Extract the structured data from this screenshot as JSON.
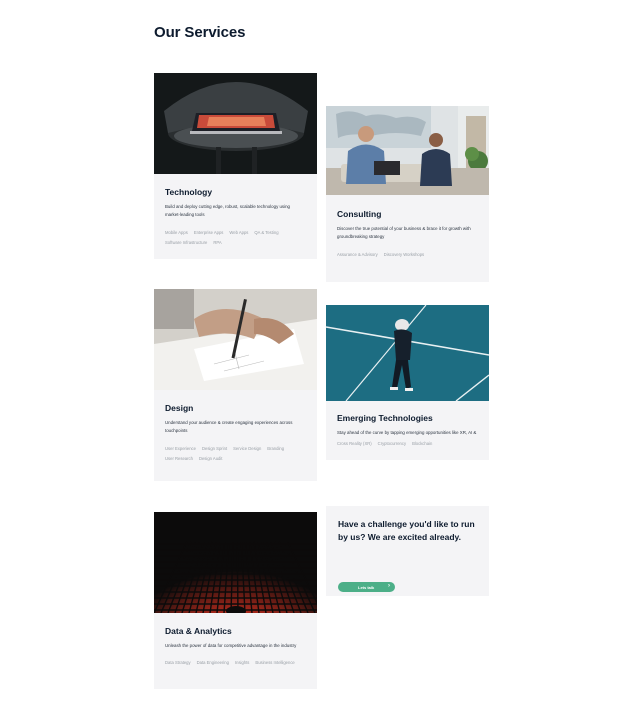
{
  "page": {
    "title": "Our Services"
  },
  "cards": {
    "technology": {
      "title": "Technology",
      "description": "Build and deploy cutting edge, robust, scalable technology using market-leading tools",
      "tags": [
        "Mobile Apps",
        "Enterprise Apps",
        "Web Apps",
        "QA & Testing",
        "Software Infrastructure",
        "RPA"
      ]
    },
    "consulting": {
      "title": "Consulting",
      "description": "Discover the true potential of your business & brace it for growth with groundbreaking strategy",
      "tags": [
        "Assurance & Advisory",
        "Discovery Workshops"
      ]
    },
    "design": {
      "title": "Design",
      "description": "Understand your audience & create engaging experiences across touchpoints",
      "tags": [
        "User Experience",
        "Design Sprint",
        "Service Design",
        "Branding",
        "User Research",
        "Design Audit"
      ]
    },
    "emerging": {
      "title": "Emerging Technologies",
      "description": "Stay ahead of the curve by tapping emerging opportunities like XR, AI & Blockchain",
      "tags": [
        "Cross Reality (XR)",
        "Cryptocurrency",
        "Blockchain"
      ]
    },
    "data": {
      "title": "Data & Analytics",
      "description": "Unleash the power of data for competitive advantage in the industry",
      "tags": [
        "Data Strategy",
        "Data Engineering",
        "Insights",
        "Business Intelligence"
      ]
    }
  },
  "cta": {
    "text": "Have a challenge you'd like to run by us? We are excited already.",
    "button_label": "Lets talk"
  },
  "colors": {
    "accent": "#4caf88",
    "card_bg": "#f4f4f6",
    "heading": "#0d1b2e"
  }
}
